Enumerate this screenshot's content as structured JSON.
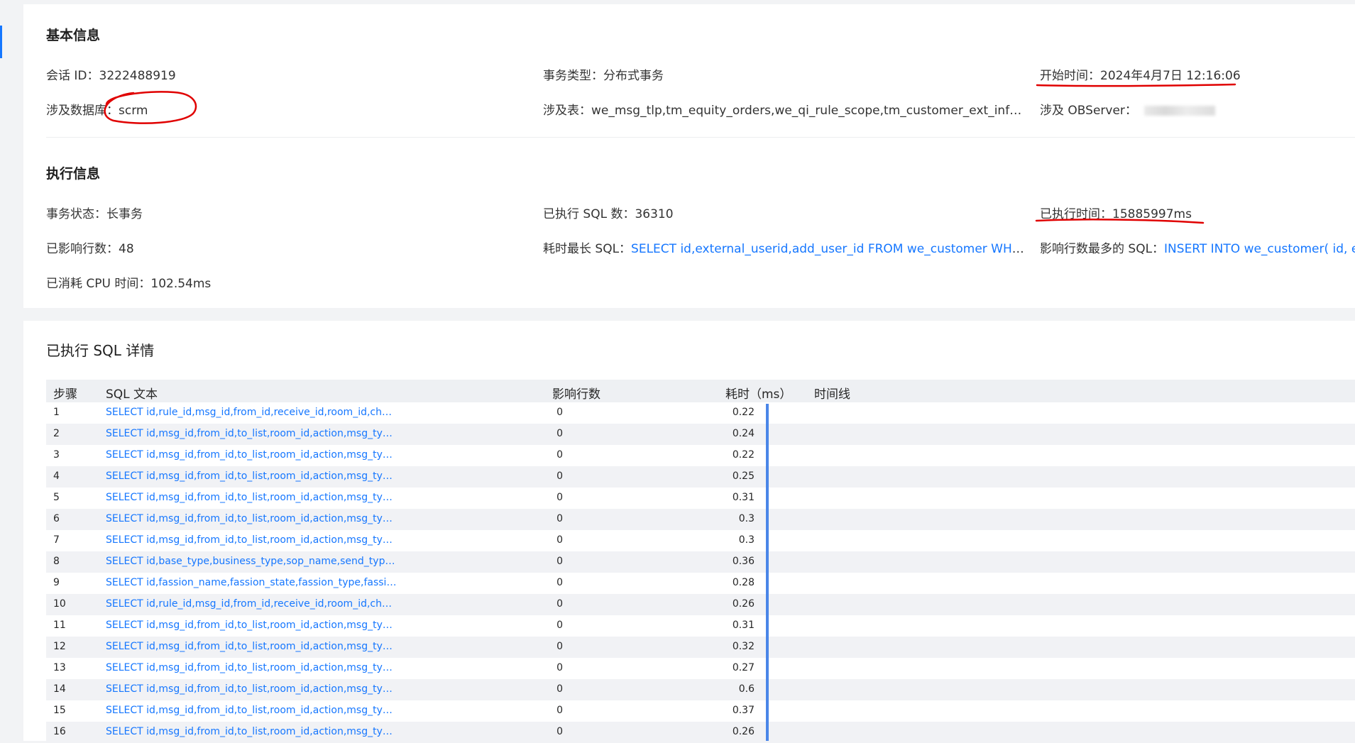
{
  "basic": {
    "title": "基本信息",
    "session_label": "会话 ID：",
    "session_value": "3222488919",
    "tx_type_label": "事务类型：",
    "tx_type_value": "分布式事务",
    "start_label": "开始时间：",
    "start_value": "2024年4月7日 12:16:06",
    "db_label": "涉及数据库：",
    "db_value": "scrm",
    "tables_label": "涉及表：",
    "tables_value": "we_msg_tlp,tm_equity_orders,we_qi_rule_scope,tm_customer_ext_info,we_sop_...",
    "observer_label": "涉及 OBServer："
  },
  "exec": {
    "title": "执行信息",
    "status_label": "事务状态：",
    "status_value": "长事务",
    "sql_count_label": "已执行 SQL 数：",
    "sql_count_value": "36310",
    "elapsed_label": "已执行时间：",
    "elapsed_value": "15885997ms",
    "affected_label": "已影响行数：",
    "affected_value": "48",
    "longest_label": "耗时最长 SQL：",
    "longest_value": "SELECT id,external_userid,add_user_id FROM we_customer WHERE del_f...",
    "most_rows_label": "影响行数最多的 SQL：",
    "most_rows_value": "INSERT INTO we_customer( id, exte",
    "cpu_label": "已消耗 CPU 时间：",
    "cpu_value": "102.54ms"
  },
  "sql_detail": {
    "title": "已执行 SQL 详情",
    "headers": {
      "step": "步骤",
      "sql": "SQL 文本",
      "rows": "影响行数",
      "time": "耗时（ms）",
      "timeline": "时间线"
    },
    "rows": [
      {
        "step": "1",
        "sql": "SELECT id,rule_id,msg_id,from_id,receive_id,room_id,chat_t...",
        "rows": "0",
        "time": "0.22"
      },
      {
        "step": "2",
        "sql": "SELECT id,msg_id,from_id,to_list,room_id,action,msg_type,...",
        "rows": "0",
        "time": "0.24"
      },
      {
        "step": "3",
        "sql": "SELECT id,msg_id,from_id,to_list,room_id,action,msg_type,...",
        "rows": "0",
        "time": "0.22"
      },
      {
        "step": "4",
        "sql": "SELECT id,msg_id,from_id,to_list,room_id,action,msg_type,...",
        "rows": "0",
        "time": "0.25"
      },
      {
        "step": "5",
        "sql": "SELECT id,msg_id,from_id,to_list,room_id,action,msg_type,...",
        "rows": "0",
        "time": "0.31"
      },
      {
        "step": "6",
        "sql": "SELECT id,msg_id,from_id,to_list,room_id,action,msg_type,...",
        "rows": "0",
        "time": "0.3"
      },
      {
        "step": "7",
        "sql": "SELECT id,msg_id,from_id,to_list,room_id,action,msg_type,...",
        "rows": "0",
        "time": "0.3"
      },
      {
        "step": "8",
        "sql": "SELECT id,base_type,business_type,sop_name,send_type,ex...",
        "rows": "0",
        "time": "0.36"
      },
      {
        "step": "9",
        "sql": "SELECT id,fassion_name,fassion_state,fassion_type,fassion_...",
        "rows": "0",
        "time": "0.28"
      },
      {
        "step": "10",
        "sql": "SELECT id,rule_id,msg_id,from_id,receive_id,room_id,chat_t...",
        "rows": "0",
        "time": "0.26"
      },
      {
        "step": "11",
        "sql": "SELECT id,msg_id,from_id,to_list,room_id,action,msg_type,...",
        "rows": "0",
        "time": "0.31"
      },
      {
        "step": "12",
        "sql": "SELECT id,msg_id,from_id,to_list,room_id,action,msg_type,...",
        "rows": "0",
        "time": "0.32"
      },
      {
        "step": "13",
        "sql": "SELECT id,msg_id,from_id,to_list,room_id,action,msg_type,...",
        "rows": "0",
        "time": "0.27"
      },
      {
        "step": "14",
        "sql": "SELECT id,msg_id,from_id,to_list,room_id,action,msg_type,...",
        "rows": "0",
        "time": "0.6"
      },
      {
        "step": "15",
        "sql": "SELECT id,msg_id,from_id,to_list,room_id,action,msg_type,...",
        "rows": "0",
        "time": "0.37"
      },
      {
        "step": "16",
        "sql": "SELECT id,msg_id,from_id,to_list,room_id,action,msg_type,...",
        "rows": "0",
        "time": "0.26"
      }
    ]
  },
  "colors": {
    "link": "#1677ff",
    "annotation": "#e00000",
    "timeline": "#4a86e8"
  }
}
